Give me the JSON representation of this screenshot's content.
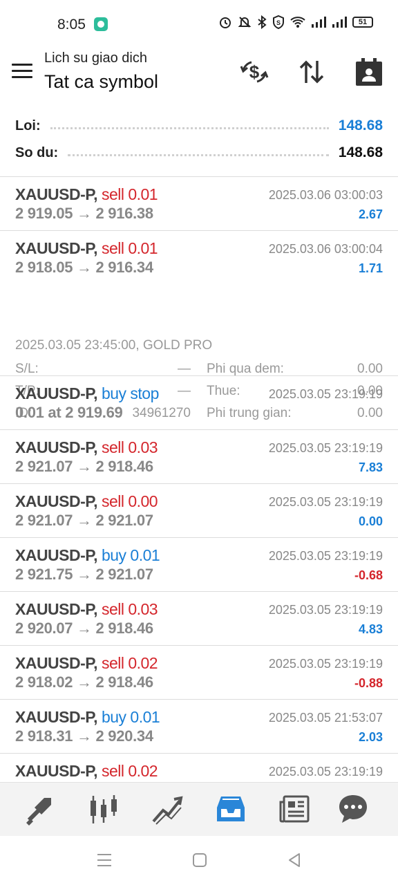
{
  "status_bar": {
    "time": "8:05",
    "battery": "51",
    "icons": [
      "app-notification-icon",
      "alarm-icon",
      "mute-icon",
      "bluetooth-icon",
      "vpn-shield-icon",
      "wifi-icon",
      "signal-icon",
      "signal-icon",
      "battery-icon"
    ]
  },
  "header": {
    "subtitle": "Lich su giao dich",
    "title": "Tat ca symbol",
    "icons": [
      "menu-icon",
      "currency-exchange-icon",
      "sort-icon",
      "calendar-icon"
    ]
  },
  "summary": {
    "profit_label": "Loi:",
    "profit_value": "148.68",
    "balance_label": "So du:",
    "balance_value": "148.68"
  },
  "colors": {
    "sell": "#d4262c",
    "buy": "#1a7fd6",
    "positive": "#1a7fd6",
    "negative": "#d4262c",
    "muted": "#888888"
  },
  "deals": [
    {
      "symbol": "XAUUSD-P,",
      "action": "sell 0.01",
      "side": "sell",
      "time": "2025.03.06 03:00:03",
      "prices": "2 919.05 → 2 916.38",
      "profit": "2.67",
      "sign": "pos"
    },
    {
      "symbol": "XAUUSD-P,",
      "action": "sell 0.01",
      "side": "sell",
      "time": "2025.03.06 03:00:04",
      "prices": "2 918.05 → 2 916.34",
      "profit": "1.71",
      "sign": "pos",
      "details": {
        "open_info": "2025.03.05 23:45:00, GOLD PRO",
        "sl_label": "S/L:",
        "sl_value": "—",
        "tp_label": "T/P:",
        "tp_value": "—",
        "id_label": "ID:",
        "id_value": "34961270",
        "swap_label": "Phi qua dem:",
        "swap_value": "0.00",
        "tax_label": "Thue:",
        "tax_value": "0.00",
        "commission_label": "Phi trung gian:",
        "commission_value": "0.00"
      }
    },
    {
      "symbol": "XAUUSD-P,",
      "action": "buy stop",
      "side": "buy",
      "time": "2025.03.05 23:19:19",
      "prices": "0.01 at 2 919.69",
      "profit": "",
      "sign": "pos"
    },
    {
      "symbol": "XAUUSD-P,",
      "action": "sell 0.03",
      "side": "sell",
      "time": "2025.03.05 23:19:19",
      "prices": "2 921.07 → 2 918.46",
      "profit": "7.83",
      "sign": "pos"
    },
    {
      "symbol": "XAUUSD-P,",
      "action": "sell 0.00",
      "side": "sell",
      "time": "2025.03.05 23:19:19",
      "prices": "2 921.07 → 2 921.07",
      "profit": "0.00",
      "sign": "pos"
    },
    {
      "symbol": "XAUUSD-P,",
      "action": "buy 0.01",
      "side": "buy",
      "time": "2025.03.05 23:19:19",
      "prices": "2 921.75 → 2 921.07",
      "profit": "-0.68",
      "sign": "neg"
    },
    {
      "symbol": "XAUUSD-P,",
      "action": "sell 0.03",
      "side": "sell",
      "time": "2025.03.05 23:19:19",
      "prices": "2 920.07 → 2 918.46",
      "profit": "4.83",
      "sign": "pos"
    },
    {
      "symbol": "XAUUSD-P,",
      "action": "sell 0.02",
      "side": "sell",
      "time": "2025.03.05 23:19:19",
      "prices": "2 918.02 → 2 918.46",
      "profit": "-0.88",
      "sign": "neg"
    },
    {
      "symbol": "XAUUSD-P,",
      "action": "buy 0.01",
      "side": "buy",
      "time": "2025.03.05 21:53:07",
      "prices": "2 918.31 → 2 920.34",
      "profit": "2.03",
      "sign": "pos"
    },
    {
      "symbol": "XAUUSD-P,",
      "action": "sell 0.02",
      "side": "sell",
      "time": "2025.03.05 23:19:19",
      "prices": "",
      "profit": "",
      "sign": "pos"
    }
  ],
  "bottom_nav": {
    "items": [
      "trade-icon",
      "chart-icon",
      "analytics-icon",
      "history-icon",
      "news-icon",
      "chat-icon"
    ],
    "active": "history-icon"
  },
  "system_nav": [
    "recent-apps-icon",
    "home-icon",
    "back-icon"
  ]
}
